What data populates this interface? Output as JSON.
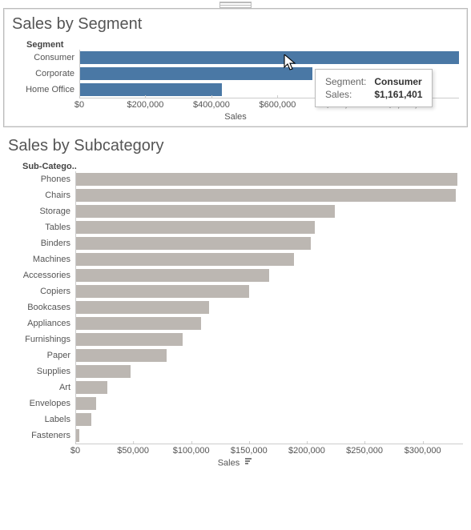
{
  "handle": {
    "name": "drag-handle"
  },
  "chart_data": [
    {
      "type": "bar",
      "title": "Sales by Segment",
      "axis_header": "Segment",
      "categories": [
        "Consumer",
        "Corporate",
        "Home Office"
      ],
      "values": [
        1161401,
        706000,
        430000
      ],
      "xlabel": "Sales",
      "xlim": [
        0,
        1150000
      ],
      "xticks": [
        "$0",
        "$200,000",
        "$400,000",
        "$600,000",
        "$800,000",
        "$1,000,000"
      ],
      "bar_color": "#4a78a5",
      "tooltip": {
        "visible": true,
        "fields": [
          {
            "label": "Segment:",
            "value": "Consumer"
          },
          {
            "label": "Sales:",
            "value": "$1,161,401"
          }
        ]
      }
    },
    {
      "type": "bar",
      "title": "Sales by Subcategory",
      "axis_header": "Sub-Catego..",
      "categories": [
        "Phones",
        "Chairs",
        "Storage",
        "Tables",
        "Binders",
        "Machines",
        "Accessories",
        "Copiers",
        "Bookcases",
        "Appliances",
        "Furnishings",
        "Paper",
        "Supplies",
        "Art",
        "Envelopes",
        "Labels",
        "Fasteners"
      ],
      "values": [
        330000,
        329000,
        224000,
        207000,
        203000,
        189000,
        167000,
        150000,
        115000,
        108000,
        92000,
        78000,
        47000,
        27000,
        17000,
        13000,
        3000
      ],
      "xlabel": "Sales",
      "xlim": [
        0,
        335000
      ],
      "xticks": [
        "$0",
        "$50,000",
        "$100,000",
        "$150,000",
        "$200,000",
        "$250,000",
        "$300,000"
      ],
      "bar_color": "#bcb7b2",
      "sort": "desc"
    }
  ]
}
